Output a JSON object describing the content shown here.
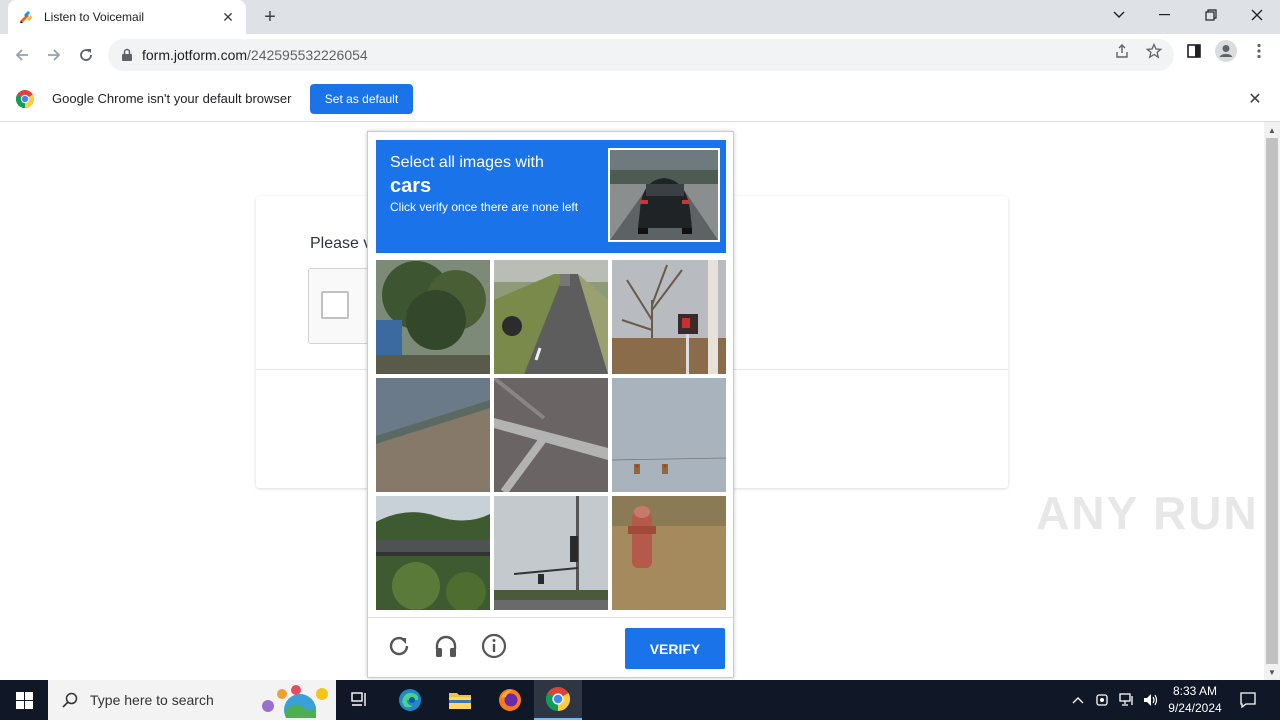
{
  "browser": {
    "tab_title": "Listen to Voicemail",
    "url_host": "form.jotform.com",
    "url_path": "/242595532226054"
  },
  "infobar": {
    "message": "Google Chrome isn't your default browser",
    "button_label": "Set as default"
  },
  "form": {
    "label": "Please v"
  },
  "challenge": {
    "line1": "Select all images with",
    "keyword": "cars",
    "line3": "Click verify once there are none left",
    "tiles": [
      {
        "subject": "trees-roadside"
      },
      {
        "subject": "road-with-car"
      },
      {
        "subject": "bare-tree-crosswalk-signal"
      },
      {
        "subject": "road-wall"
      },
      {
        "subject": "road-crosswalk"
      },
      {
        "subject": "traffic-lights-sky"
      },
      {
        "subject": "bridge-forest"
      },
      {
        "subject": "traffic-light-pole"
      },
      {
        "subject": "fire-hydrant"
      }
    ],
    "verify_label": "VERIFY"
  },
  "watermark": "ANY RUN",
  "taskbar": {
    "search_placeholder": "Type here to search",
    "time": "8:33 AM",
    "date": "9/24/2024"
  },
  "colors": {
    "accent": "#1a73e8",
    "taskbar": "#101827"
  }
}
